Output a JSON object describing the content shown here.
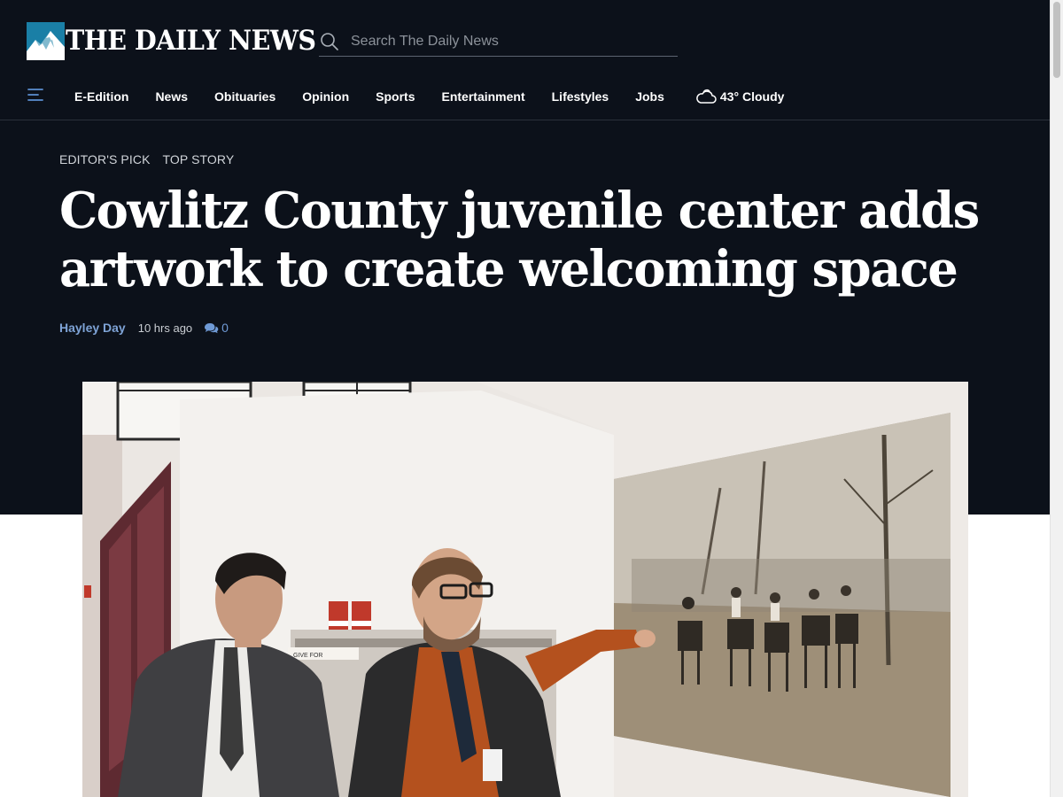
{
  "header": {
    "logo_text": "THE DAILY NEWS",
    "search_placeholder": "Search The Daily News"
  },
  "nav": {
    "items": [
      {
        "label": "E-Edition"
      },
      {
        "label": "News"
      },
      {
        "label": "Obituaries"
      },
      {
        "label": "Opinion"
      },
      {
        "label": "Sports"
      },
      {
        "label": "Entertainment"
      },
      {
        "label": "Lifestyles"
      },
      {
        "label": "Jobs"
      }
    ],
    "weather": {
      "text": "43° Cloudy",
      "icon": "cloud-icon"
    }
  },
  "article": {
    "kickers": [
      "EDITOR'S PICK",
      "TOP STORY"
    ],
    "headline_line1": "Cowlitz County juvenile center adds",
    "headline_line2": "artwork to create welcoming space",
    "author": "Hayley Day",
    "time": "10 hrs ago",
    "comments_count": "0"
  },
  "photo": {
    "signage_text": "GIVE FOR"
  },
  "colors": {
    "background_dark": "#0c111a",
    "logo_accent": "#1a7fa6",
    "author_link": "#7ea3d6",
    "comment_link": "#6f9ad6"
  }
}
